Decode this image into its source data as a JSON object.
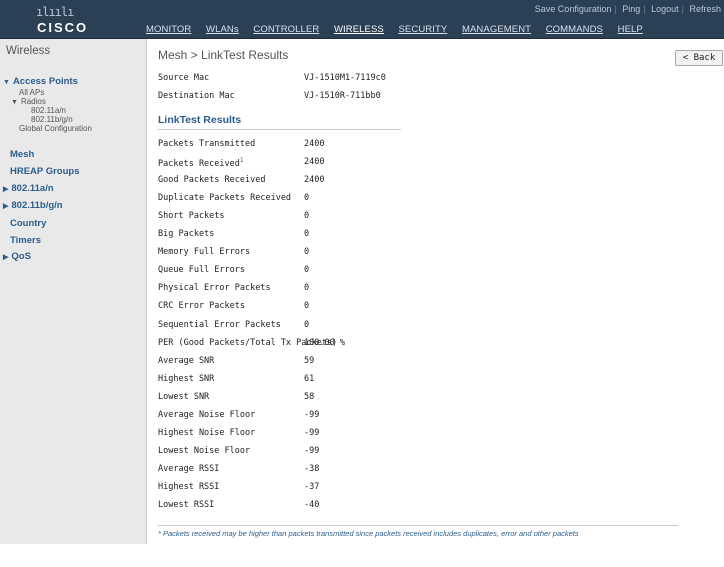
{
  "brand": {
    "bars": "ılıılı",
    "name": "CISCO"
  },
  "top_links": [
    "Save Configuration",
    "Ping",
    "Logout",
    "Refresh"
  ],
  "menu": [
    "MONITOR",
    "WLANs",
    "CONTROLLER",
    "WIRELESS",
    "SECURITY",
    "MANAGEMENT",
    "COMMANDS",
    "HELP"
  ],
  "active_menu": "WIRELESS",
  "sidebar": {
    "title": "Wireless",
    "access_points": "Access Points",
    "all_aps": "All APs",
    "radios": "Radios",
    "radio_a": "802.11a/n",
    "radio_b": "802.11b/g/n",
    "global_config": "Global Configuration",
    "mesh": "Mesh",
    "hreap": "HREAP Groups",
    "a_n": "802.11a/n",
    "b_g_n": "802.11b/g/n",
    "country": "Country",
    "timers": "Timers",
    "qos": "QoS"
  },
  "page": {
    "title": "Mesh > LinkTest Results",
    "back_label": "< Back",
    "source_label": "Source Mac",
    "source_value": "VJ-1510M1-7119c0",
    "dest_label": "Destination Mac",
    "dest_value": "VJ-1510R-711bb0",
    "section": "LinkTest Results",
    "results": [
      [
        "Packets Transmitted",
        "2400"
      ],
      [
        "Packets Received",
        "2400"
      ],
      [
        "Good Packets Received",
        "2400"
      ],
      [
        "Duplicate Packets Received",
        "0"
      ],
      [
        "Short Packets",
        "0"
      ],
      [
        "Big Packets",
        "0"
      ],
      [
        "Memory Full Errors",
        "0"
      ],
      [
        "Queue Full Errors",
        "0"
      ],
      [
        "Physical Error Packets",
        "0"
      ],
      [
        "CRC Error Packets",
        "0"
      ],
      [
        "Sequential Error Packets",
        "0"
      ],
      [
        "PER (Good Packets/Total Tx Packets)",
        "100.00 %"
      ],
      [
        "Average SNR",
        "59"
      ],
      [
        "Highest SNR",
        "61"
      ],
      [
        "Lowest SNR",
        "58"
      ],
      [
        "Average Noise Floor",
        "-99"
      ],
      [
        "Highest Noise Floor",
        "-99"
      ],
      [
        "Lowest Noise Floor",
        "-99"
      ],
      [
        "Average RSSI",
        "-38"
      ],
      [
        "Highest RSSI",
        "-37"
      ],
      [
        "Lowest RSSI",
        "-40"
      ]
    ],
    "footnote_mark": "1",
    "footnote": "* Packets received may be higher than packets transmitted since packets received includes duplicates, error and other packets"
  },
  "side_id": "231457"
}
